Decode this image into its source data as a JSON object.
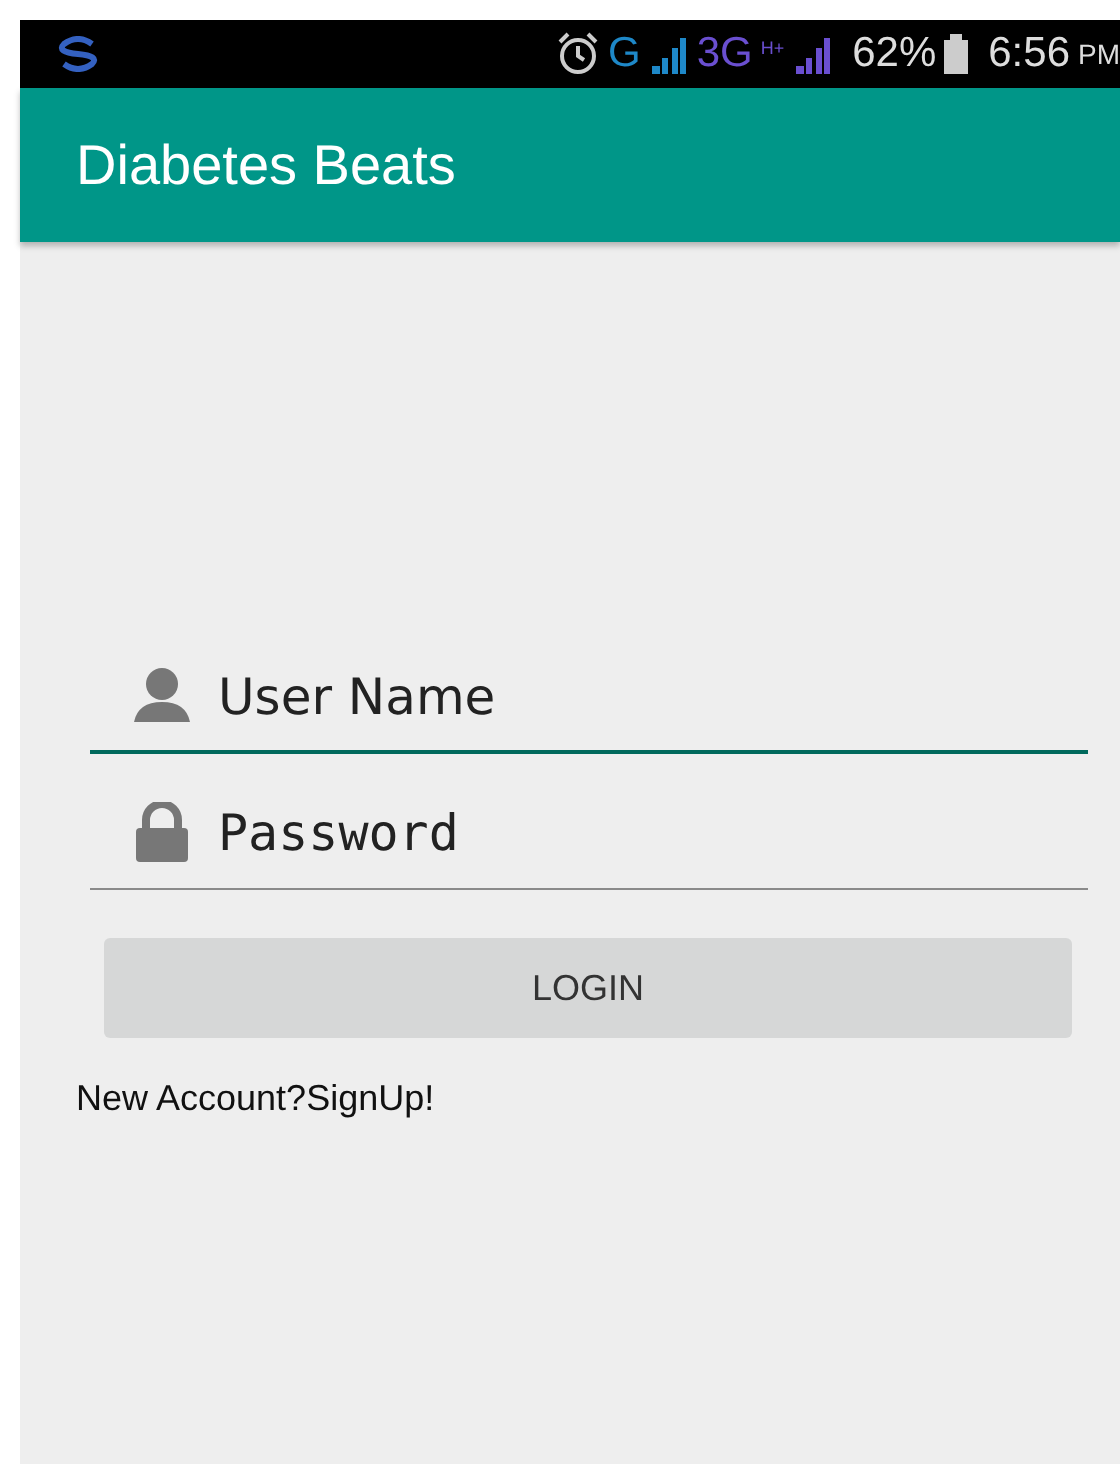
{
  "status_bar": {
    "network_1": "G",
    "network_2": "3G",
    "network_2_badge": "H+",
    "battery": "62%",
    "time": "6:56",
    "meridiem": "PM"
  },
  "app_bar": {
    "title": "Diabetes Beats"
  },
  "fields": [
    {
      "kind": "user",
      "placeholder": "User Name",
      "focused": true
    },
    {
      "kind": "password",
      "placeholder": "Password",
      "focused": false
    }
  ],
  "login_button": "LOGIN",
  "signup_link": "New Account?SignUp!"
}
